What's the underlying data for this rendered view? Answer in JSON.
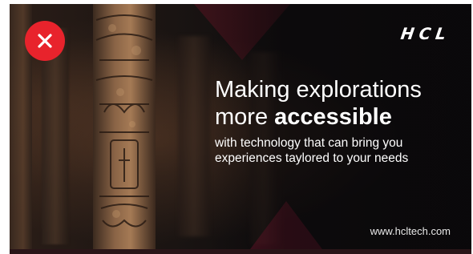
{
  "ad": {
    "logo": "HCL",
    "headline_line1": "Making explorations",
    "headline_line2_prefix": "more ",
    "headline_line2_bold": "accessible",
    "subline_line1": "with technology that can bring you",
    "subline_line2": "experiences taylored to your needs",
    "url": "www.hcltech.com"
  },
  "controls": {
    "close_icon": "close-icon"
  },
  "colors": {
    "accent_red": "#e8232c",
    "triangle_crimson": "#961937",
    "background": "#0d0d0f"
  }
}
